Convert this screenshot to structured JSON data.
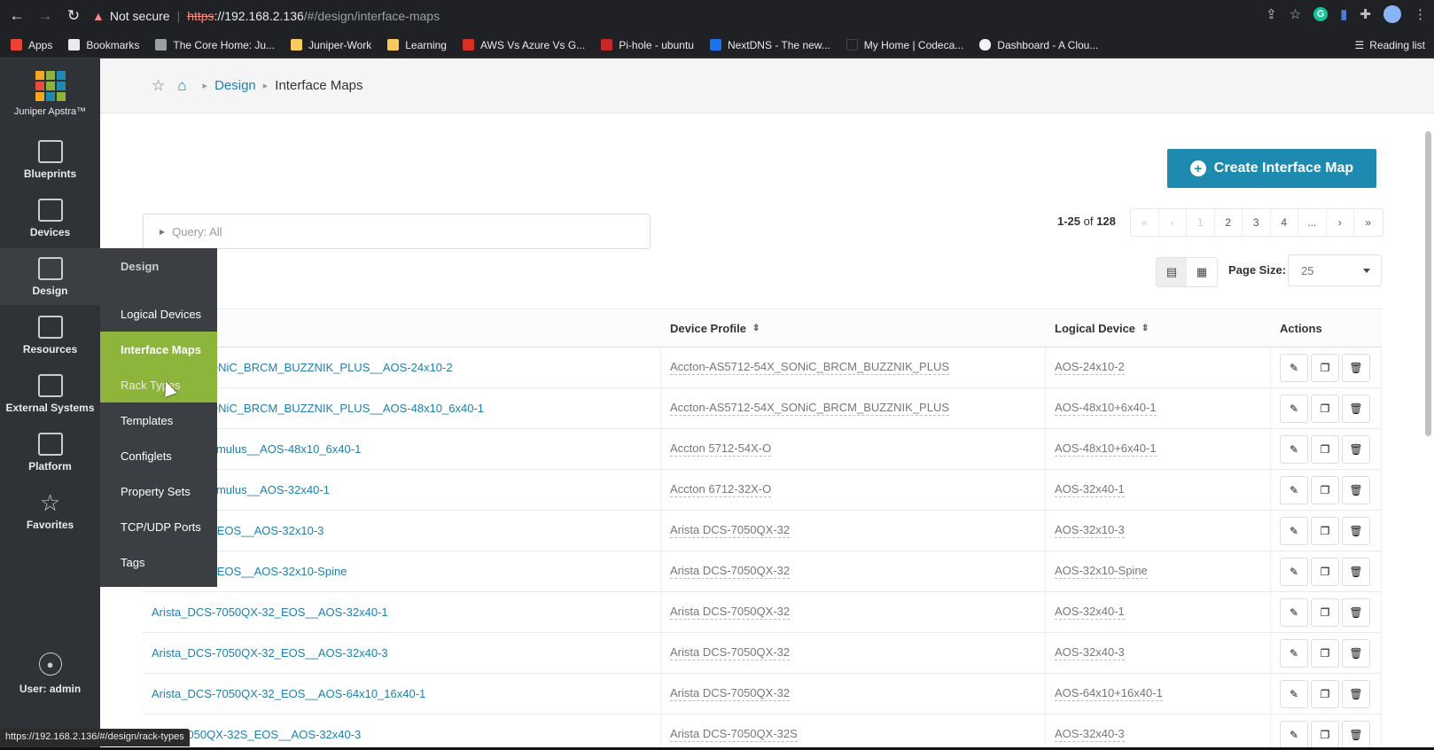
{
  "browser": {
    "security_label": "Not secure",
    "url_protocol": "https",
    "url_host": "://192.168.2.136",
    "url_path": "/#/design/interface-maps",
    "status_url": "https://192.168.2.136/#/design/rack-types",
    "reading_list": "Reading list"
  },
  "bookmarks": [
    {
      "label": "Apps",
      "color": "#ea4335"
    },
    {
      "label": "Bookmarks",
      "color": "#e8eaed"
    },
    {
      "label": "The Core Home: Ju...",
      "color": "#9aa0a6"
    },
    {
      "label": "Juniper-Work",
      "color": "#f9cb5f"
    },
    {
      "label": "Learning",
      "color": "#f9cb5f"
    },
    {
      "label": "AWS Vs Azure Vs G...",
      "color": "#d93025"
    },
    {
      "label": "Pi-hole - ubuntu",
      "color": "#c62828"
    },
    {
      "label": "NextDNS - The new...",
      "color": "#1a73e8"
    },
    {
      "label": "My Home | Codeca...",
      "color": "#202124"
    },
    {
      "label": "Dashboard - A Clou...",
      "color": "#f1f3f4"
    }
  ],
  "sidebar": {
    "brand": "Juniper Apstra™",
    "items": [
      {
        "label": "Blueprints"
      },
      {
        "label": "Devices"
      },
      {
        "label": "Design"
      },
      {
        "label": "Resources"
      },
      {
        "label": "External Systems"
      },
      {
        "label": "Platform"
      },
      {
        "label": "Favorites"
      }
    ],
    "user": "User: admin"
  },
  "flyout": {
    "title": "Design",
    "items": [
      {
        "label": "Logical Devices"
      },
      {
        "label": "Interface Maps"
      },
      {
        "label": "Rack Types"
      },
      {
        "label": "Templates"
      },
      {
        "label": "Configlets"
      },
      {
        "label": "Property Sets"
      },
      {
        "label": "TCP/UDP Ports"
      },
      {
        "label": "Tags"
      }
    ]
  },
  "breadcrumb": {
    "design": "Design",
    "current": "Interface Maps"
  },
  "create_button": "Create Interface Map",
  "query": "Query: All",
  "pagination": {
    "range": "1-25",
    "of": "of",
    "total": "128",
    "first": "«",
    "prev": "‹",
    "pages": [
      "1",
      "2",
      "3",
      "4",
      "..."
    ],
    "next": "›",
    "last": "»"
  },
  "page_size": {
    "label": "Page Size:",
    "value": "25"
  },
  "table": {
    "columns": {
      "device_profile": "Device Profile",
      "logical_device": "Logical Device",
      "actions": "Actions"
    },
    "rows": [
      {
        "name": "712-54X_SONiC_BRCM_BUZZNIK_PLUS__AOS-24x10-2",
        "device_profile": "Accton-AS5712-54X_SONiC_BRCM_BUZZNIK_PLUS",
        "logical_device": "AOS-24x10-2"
      },
      {
        "name": "712-54X_SONiC_BRCM_BUZZNIK_PLUS__AOS-48x10_6x40-1",
        "device_profile": "Accton-AS5712-54X_SONiC_BRCM_BUZZNIK_PLUS",
        "logical_device": "AOS-48x10+6x40-1"
      },
      {
        "name": "2-54X-O_Cumulus__AOS-48x10_6x40-1",
        "device_profile": "Accton 5712-54X-O",
        "logical_device": "AOS-48x10+6x40-1"
      },
      {
        "name": "2-32X-O_Cumulus__AOS-32x40-1",
        "device_profile": "Accton 6712-32X-O",
        "logical_device": "AOS-32x40-1"
      },
      {
        "name": "7050QX-32_EOS__AOS-32x10-3",
        "device_profile": "Arista DCS-7050QX-32",
        "logical_device": "AOS-32x10-3"
      },
      {
        "name": "7050QX-32_EOS__AOS-32x10-Spine",
        "device_profile": "Arista DCS-7050QX-32",
        "logical_device": "AOS-32x10-Spine"
      },
      {
        "name": "Arista_DCS-7050QX-32_EOS__AOS-32x40-1",
        "device_profile": "Arista DCS-7050QX-32",
        "logical_device": "AOS-32x40-1"
      },
      {
        "name": "Arista_DCS-7050QX-32_EOS__AOS-32x40-3",
        "device_profile": "Arista DCS-7050QX-32",
        "logical_device": "AOS-32x40-3"
      },
      {
        "name": "Arista_DCS-7050QX-32_EOS__AOS-64x10_16x40-1",
        "device_profile": "Arista DCS-7050QX-32",
        "logical_device": "AOS-64x10+16x40-1"
      },
      {
        "name": "...CS-7050QX-32S_EOS__AOS-32x40-3",
        "device_profile": "Arista DCS-7050QX-32S",
        "logical_device": "AOS-32x40-3"
      }
    ]
  },
  "colors": {
    "accent": "#1f8aaf",
    "menu_active": "#8db53c",
    "sidebar": "#2f3236"
  }
}
